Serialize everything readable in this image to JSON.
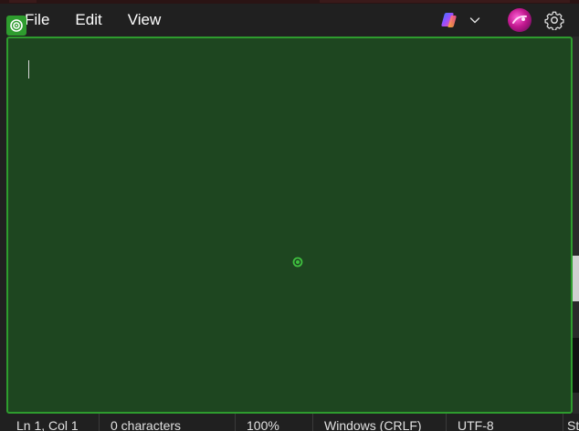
{
  "menu": {
    "file": "File",
    "edit": "Edit",
    "view": "View"
  },
  "toolbar": {
    "copilot_icon": "copilot-icon",
    "dropdown_icon": "chevron-down-icon",
    "avatar_icon": "avatar",
    "settings_icon": "gear-icon"
  },
  "editor": {
    "content": "",
    "highlight_color": "#2e9c2e",
    "fill_color": "#1e4620"
  },
  "status": {
    "position": "Ln 1, Col 1",
    "characters": "0 characters",
    "zoom": "100%",
    "line_endings": "Windows (CRLF)",
    "encoding": "UTF-8",
    "overflow": "St"
  }
}
